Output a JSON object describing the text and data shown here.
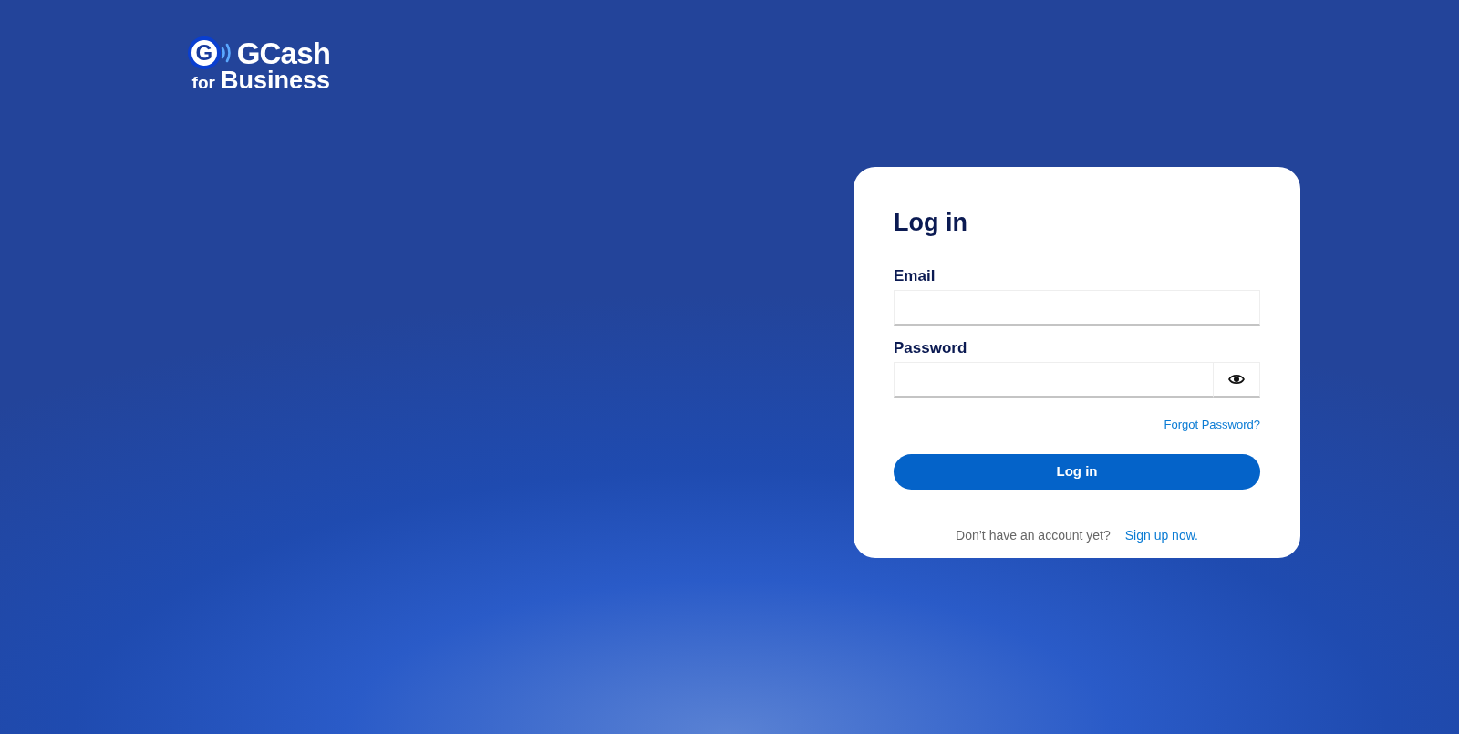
{
  "logo": {
    "mark": "G",
    "name": "GCash",
    "prefix": "for",
    "suffix": "Business"
  },
  "login_card": {
    "title": "Log in",
    "fields": [
      {
        "kind": "text",
        "label": "Email"
      },
      {
        "kind": "password",
        "label": "Password"
      }
    ],
    "forgot_link": "Forgot Password?",
    "submit_button": "Log in",
    "signup_prompt": "Don’t have an account yet?",
    "signup_link": "Sign up now."
  }
}
